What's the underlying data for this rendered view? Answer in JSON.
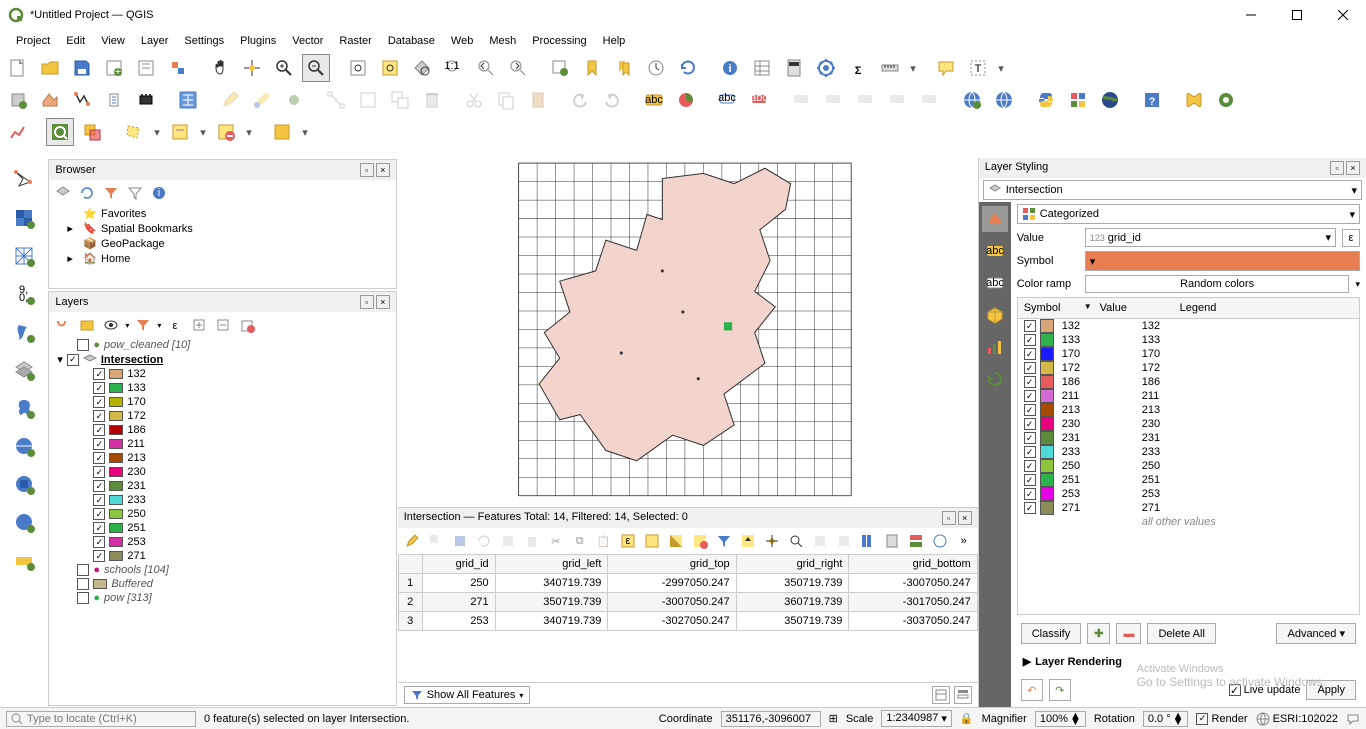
{
  "title": "*Untitled Project — QGIS",
  "menu": [
    "Project",
    "Edit",
    "View",
    "Layer",
    "Settings",
    "Plugins",
    "Vector",
    "Raster",
    "Database",
    "Web",
    "Mesh",
    "Processing",
    "Help"
  ],
  "panels": {
    "browser": {
      "title": "Browser",
      "items": [
        "Favorites",
        "Spatial Bookmarks",
        "GeoPackage",
        "Home"
      ]
    },
    "layers": {
      "title": "Layers",
      "top_layer": "pow_cleaned [10]",
      "group": "Intersection",
      "categories": [
        {
          "v": "132",
          "c": "#d9a679"
        },
        {
          "v": "133",
          "c": "#2bb24c"
        },
        {
          "v": "170",
          "c": "#b3b300"
        },
        {
          "v": "172",
          "c": "#d6b84a"
        },
        {
          "v": "186",
          "c": "#b30000"
        },
        {
          "v": "211",
          "c": "#d430a6"
        },
        {
          "v": "213",
          "c": "#a64b00"
        },
        {
          "v": "230",
          "c": "#e6007e"
        },
        {
          "v": "231",
          "c": "#5a8c3a"
        },
        {
          "v": "233",
          "c": "#4fd9d9"
        },
        {
          "v": "250",
          "c": "#8cc63f"
        },
        {
          "v": "251",
          "c": "#2bb24c"
        },
        {
          "v": "253",
          "c": "#d430a6"
        },
        {
          "v": "271",
          "c": "#8c8c5a"
        }
      ],
      "other_layers": [
        {
          "name": "schools [104]",
          "c": "#c71585",
          "chk": false
        },
        {
          "name": "Buffered",
          "c": "#c4b78a",
          "chk": false,
          "square": true
        },
        {
          "name": "pow [313]",
          "c": "#2bb24c",
          "chk": false
        }
      ]
    }
  },
  "attr": {
    "title": "Intersection — Features Total: 14, Filtered: 14, Selected: 0",
    "columns": [
      "grid_id",
      "grid_left",
      "grid_top",
      "grid_right",
      "grid_bottom"
    ],
    "rows": [
      [
        "250",
        "340719.739",
        "-2997050.247",
        "350719.739",
        "-3007050.247"
      ],
      [
        "271",
        "350719.739",
        "-3007050.247",
        "360719.739",
        "-3017050.247"
      ],
      [
        "253",
        "340719.739",
        "-3027050.247",
        "350719.739",
        "-3037050.247"
      ]
    ],
    "footer_btn": "Show All Features"
  },
  "style": {
    "title": "Layer Styling",
    "layer": "Intersection",
    "renderer": "Categorized",
    "value_label": "Value",
    "value": "grid_id",
    "value_prefix": "123",
    "symbol_label": "Symbol",
    "symbol_color": "#e67e52",
    "ramp_label": "Color ramp",
    "ramp": "Random colors",
    "headers": {
      "symbol": "Symbol",
      "value": "Value",
      "legend": "Legend"
    },
    "cats": [
      {
        "v": "132",
        "c": "#d9a679"
      },
      {
        "v": "133",
        "c": "#2bb24c"
      },
      {
        "v": "170",
        "c": "#1a1aff"
      },
      {
        "v": "172",
        "c": "#d6b84a"
      },
      {
        "v": "186",
        "c": "#e65c5c"
      },
      {
        "v": "211",
        "c": "#d46bd4"
      },
      {
        "v": "213",
        "c": "#a64b00"
      },
      {
        "v": "230",
        "c": "#e6007e"
      },
      {
        "v": "231",
        "c": "#5a8c3a"
      },
      {
        "v": "233",
        "c": "#4fd9d9"
      },
      {
        "v": "250",
        "c": "#8cc63f"
      },
      {
        "v": "251",
        "c": "#2bb24c"
      },
      {
        "v": "253",
        "c": "#e600e6"
      },
      {
        "v": "271",
        "c": "#8c8c5a"
      }
    ],
    "all_other": "all other values",
    "buttons": {
      "classify": "Classify",
      "delete": "Delete All",
      "advanced": "Advanced"
    },
    "rendering": "Layer Rendering",
    "live": "Live update",
    "apply": "Apply"
  },
  "status": {
    "locator_ph": "Type to locate (Ctrl+K)",
    "sel": "0 feature(s) selected on layer Intersection.",
    "coord_lbl": "Coordinate",
    "coord": "351176,-3096007",
    "scale_lbl": "Scale",
    "scale": "1:2340987",
    "mag_lbl": "Magnifier",
    "mag": "100%",
    "rot_lbl": "Rotation",
    "rot": "0.0 °",
    "render": "Render",
    "crs": "ESRI:102022"
  },
  "watermark": {
    "l1": "Activate Windows",
    "l2": "Go to Settings to activate Windows."
  }
}
